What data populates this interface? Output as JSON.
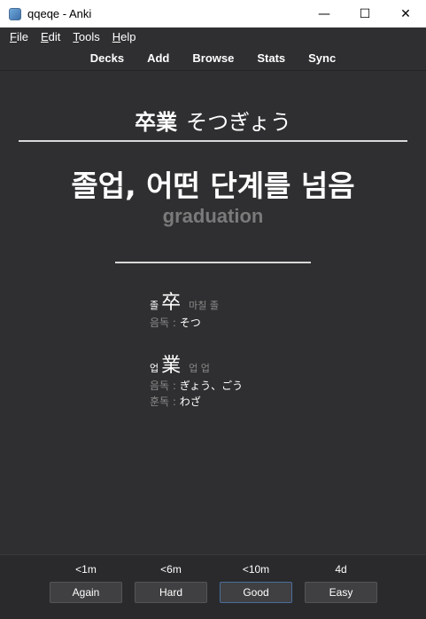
{
  "window": {
    "title": "qqeqe - Anki",
    "icon": "anki-app-icon",
    "controls": {
      "minimize": "—",
      "maximize": "☐",
      "close": "✕"
    }
  },
  "menu": {
    "file": {
      "ul": "F",
      "rest": "ile"
    },
    "edit": {
      "ul": "E",
      "rest": "dit"
    },
    "tools": {
      "ul": "T",
      "rest": "ools"
    },
    "help": {
      "ul": "H",
      "rest": "elp"
    }
  },
  "toolbar": {
    "items": [
      "Decks",
      "Add",
      "Browse",
      "Stats",
      "Sync"
    ]
  },
  "card": {
    "front_kanji": "卒業",
    "front_kana": "そつぎょう",
    "meaning_ko": "졸업, 어떤 단계를 넘음",
    "meaning_en": "graduation",
    "kanji": [
      {
        "ko_reading": "졸",
        "char": "卒",
        "meaning": "마칠 졸",
        "readings": [
          {
            "label": "음독 : ",
            "value": "そつ"
          }
        ]
      },
      {
        "ko_reading": "업",
        "char": "業",
        "meaning": "업 업",
        "readings": [
          {
            "label": "음독 : ",
            "value": "ぎょう、ごう"
          },
          {
            "label": "훈독 : ",
            "value": "わざ"
          }
        ]
      }
    ]
  },
  "answer": {
    "intervals": [
      "<1m",
      "<6m",
      "<10m",
      "4d"
    ],
    "buttons": [
      "Again",
      "Hard",
      "Good",
      "Easy"
    ],
    "default_button": "Good"
  },
  "colors": {
    "background": "#2f2f31",
    "muted_text": "#8a8a8a",
    "english_gray": "#7a7a7a",
    "default_button_border": "#4a6d9a"
  }
}
